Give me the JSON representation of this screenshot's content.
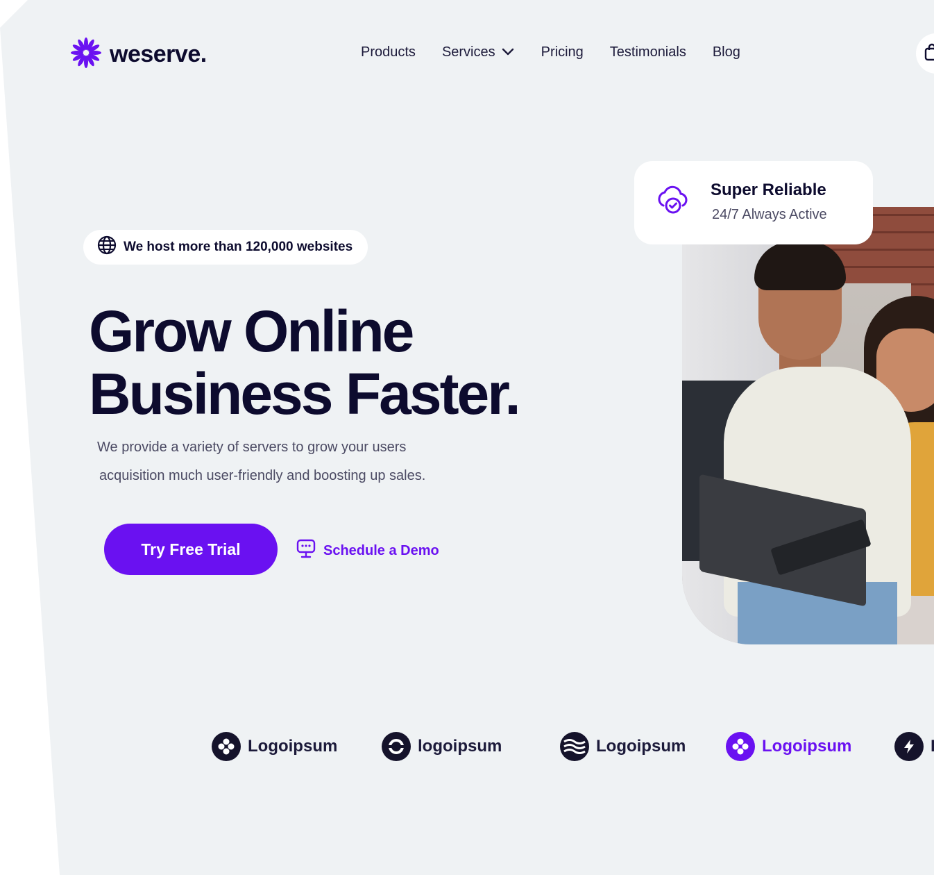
{
  "brand": {
    "name": "weserve.",
    "accent": "#6a11f1",
    "dark": "#0d0b2e"
  },
  "nav": {
    "items": [
      {
        "label": "Products"
      },
      {
        "label": "Services",
        "has_dropdown": true
      },
      {
        "label": "Pricing"
      },
      {
        "label": "Testimonials"
      },
      {
        "label": "Blog"
      }
    ],
    "cart_icon": "shopping-bag-icon"
  },
  "hero": {
    "badge": {
      "icon": "globe-icon",
      "text": "We host more than 120,000 websites"
    },
    "title_line1": "Grow Online",
    "title_line2": "Business Faster.",
    "desc_line1": "We provide a variety of servers to grow your users",
    "desc_line2": "acquisition much user-friendly and boosting up sales.",
    "primary_cta": "Try Free Trial",
    "secondary_cta": {
      "icon": "demo-chat-icon",
      "label": "Schedule a Demo"
    }
  },
  "feature_card": {
    "icon": "cloud-check-icon",
    "title": "Super Reliable",
    "subtitle": "24/7 Always Active"
  },
  "logos": [
    {
      "label": "Logoipsum",
      "icon": "clover-logo-icon"
    },
    {
      "label": "logoipsum",
      "icon": "ring-logo-icon"
    },
    {
      "label": "Logoipsum",
      "icon": "waves-logo-icon"
    },
    {
      "label": "Logoipsum",
      "icon": "clover-logo-icon",
      "highlight": true
    },
    {
      "label": "L",
      "icon": "bolt-logo-icon"
    }
  ]
}
